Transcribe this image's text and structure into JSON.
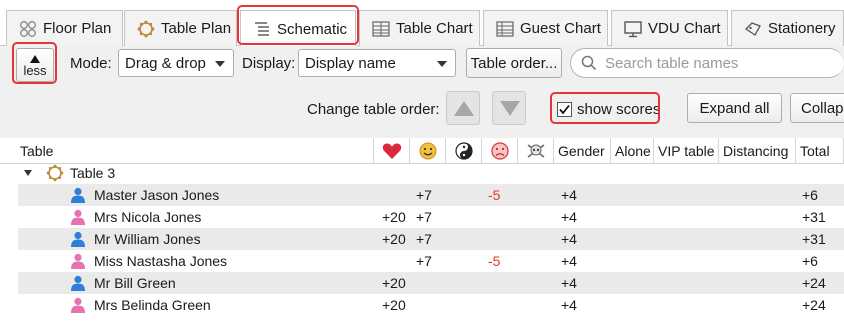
{
  "tabs": [
    {
      "label": "Floor Plan",
      "icon": "floor-plan-icon"
    },
    {
      "label": "Table Plan",
      "icon": "table-plan-icon"
    },
    {
      "label": "Schematic",
      "icon": "schematic-icon",
      "active": true
    },
    {
      "label": "Table Chart",
      "icon": "table-chart-icon"
    },
    {
      "label": "Guest Chart",
      "icon": "guest-chart-icon"
    },
    {
      "label": "VDU Chart",
      "icon": "vdu-chart-icon"
    },
    {
      "label": "Stationery",
      "icon": "stationery-icon"
    }
  ],
  "toolbar": {
    "less_label": "less",
    "mode_label": "Mode:",
    "mode_value": "Drag & drop",
    "display_label": "Display:",
    "display_value": "Display name",
    "table_order_label": "Table order...",
    "search_placeholder": "Search table names",
    "change_order_label": "Change table order:",
    "show_scores_label": "show scores",
    "show_scores_checked": true,
    "expand_all_label": "Expand all",
    "collapse_label": "Collap"
  },
  "columns": {
    "table": "Table",
    "heart": "heart-icon",
    "smile": "smile-icon",
    "yinyang": "yin-yang-icon",
    "frown": "frown-icon",
    "skull": "skull-icon",
    "gender": "Gender",
    "alone": "Alone",
    "vip": "VIP table",
    "distancing": "Distancing",
    "total": "Total"
  },
  "group": {
    "name": "Table 3"
  },
  "rows": [
    {
      "name": "Master Jason Jones",
      "gender": "male",
      "heart": "",
      "smile": "+7",
      "frown": "-5",
      "gender_score": "+4",
      "total": "+6"
    },
    {
      "name": "Mrs Nicola Jones",
      "gender": "female",
      "heart": "+20",
      "smile": "+7",
      "frown": "",
      "gender_score": "+4",
      "total": "+31"
    },
    {
      "name": "Mr William Jones",
      "gender": "male",
      "heart": "+20",
      "smile": "+7",
      "frown": "",
      "gender_score": "+4",
      "total": "+31"
    },
    {
      "name": "Miss Nastasha Jones",
      "gender": "female",
      "heart": "",
      "smile": "+7",
      "frown": "-5",
      "gender_score": "+4",
      "total": "+6"
    },
    {
      "name": "Mr Bill Green",
      "gender": "male",
      "heart": "+20",
      "smile": "",
      "frown": "",
      "gender_score": "+4",
      "total": "+24"
    },
    {
      "name": "Mrs Belinda Green",
      "gender": "female",
      "heart": "+20",
      "smile": "",
      "frown": "",
      "gender_score": "+4",
      "total": "+24"
    }
  ],
  "colors": {
    "highlight": "#e2383c",
    "male": "#2f7fd6",
    "female": "#e673b0",
    "negative": "#e03a2a",
    "heart": "#d8283a"
  }
}
